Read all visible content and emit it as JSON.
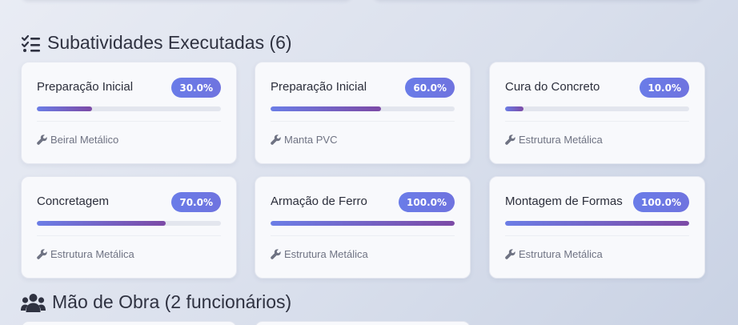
{
  "subactivities": {
    "title": "Subatividades Executadas (6)",
    "items": [
      {
        "name": "Preparação Inicial",
        "percent_label": "30.0%",
        "progress": 0.3,
        "material": "Beiral Metálico"
      },
      {
        "name": "Preparação Inicial",
        "percent_label": "60.0%",
        "progress": 0.6,
        "material": "Manta PVC"
      },
      {
        "name": "Cura do Concreto",
        "percent_label": "10.0%",
        "progress": 0.1,
        "material": "Estrutura Metálica"
      },
      {
        "name": "Concretagem",
        "percent_label": "70.0%",
        "progress": 0.7,
        "material": "Estrutura Metálica"
      },
      {
        "name": "Armação de Ferro",
        "percent_label": "100.0%",
        "progress": 1.0,
        "material": "Estrutura Metálica"
      },
      {
        "name": "Montagem de Formas",
        "percent_label": "100.0%",
        "progress": 1.0,
        "material": "Estrutura Metálica"
      }
    ]
  },
  "workforce": {
    "title": "Mão de Obra (2 funcionários)"
  },
  "icons": {
    "subactivities": "task-list-icon",
    "material": "wrench-icon",
    "workforce": "users-icon"
  },
  "colors": {
    "badge": "#6a7ce8",
    "progress_start": "#6b7de6",
    "progress_end": "#7c4aa6"
  }
}
